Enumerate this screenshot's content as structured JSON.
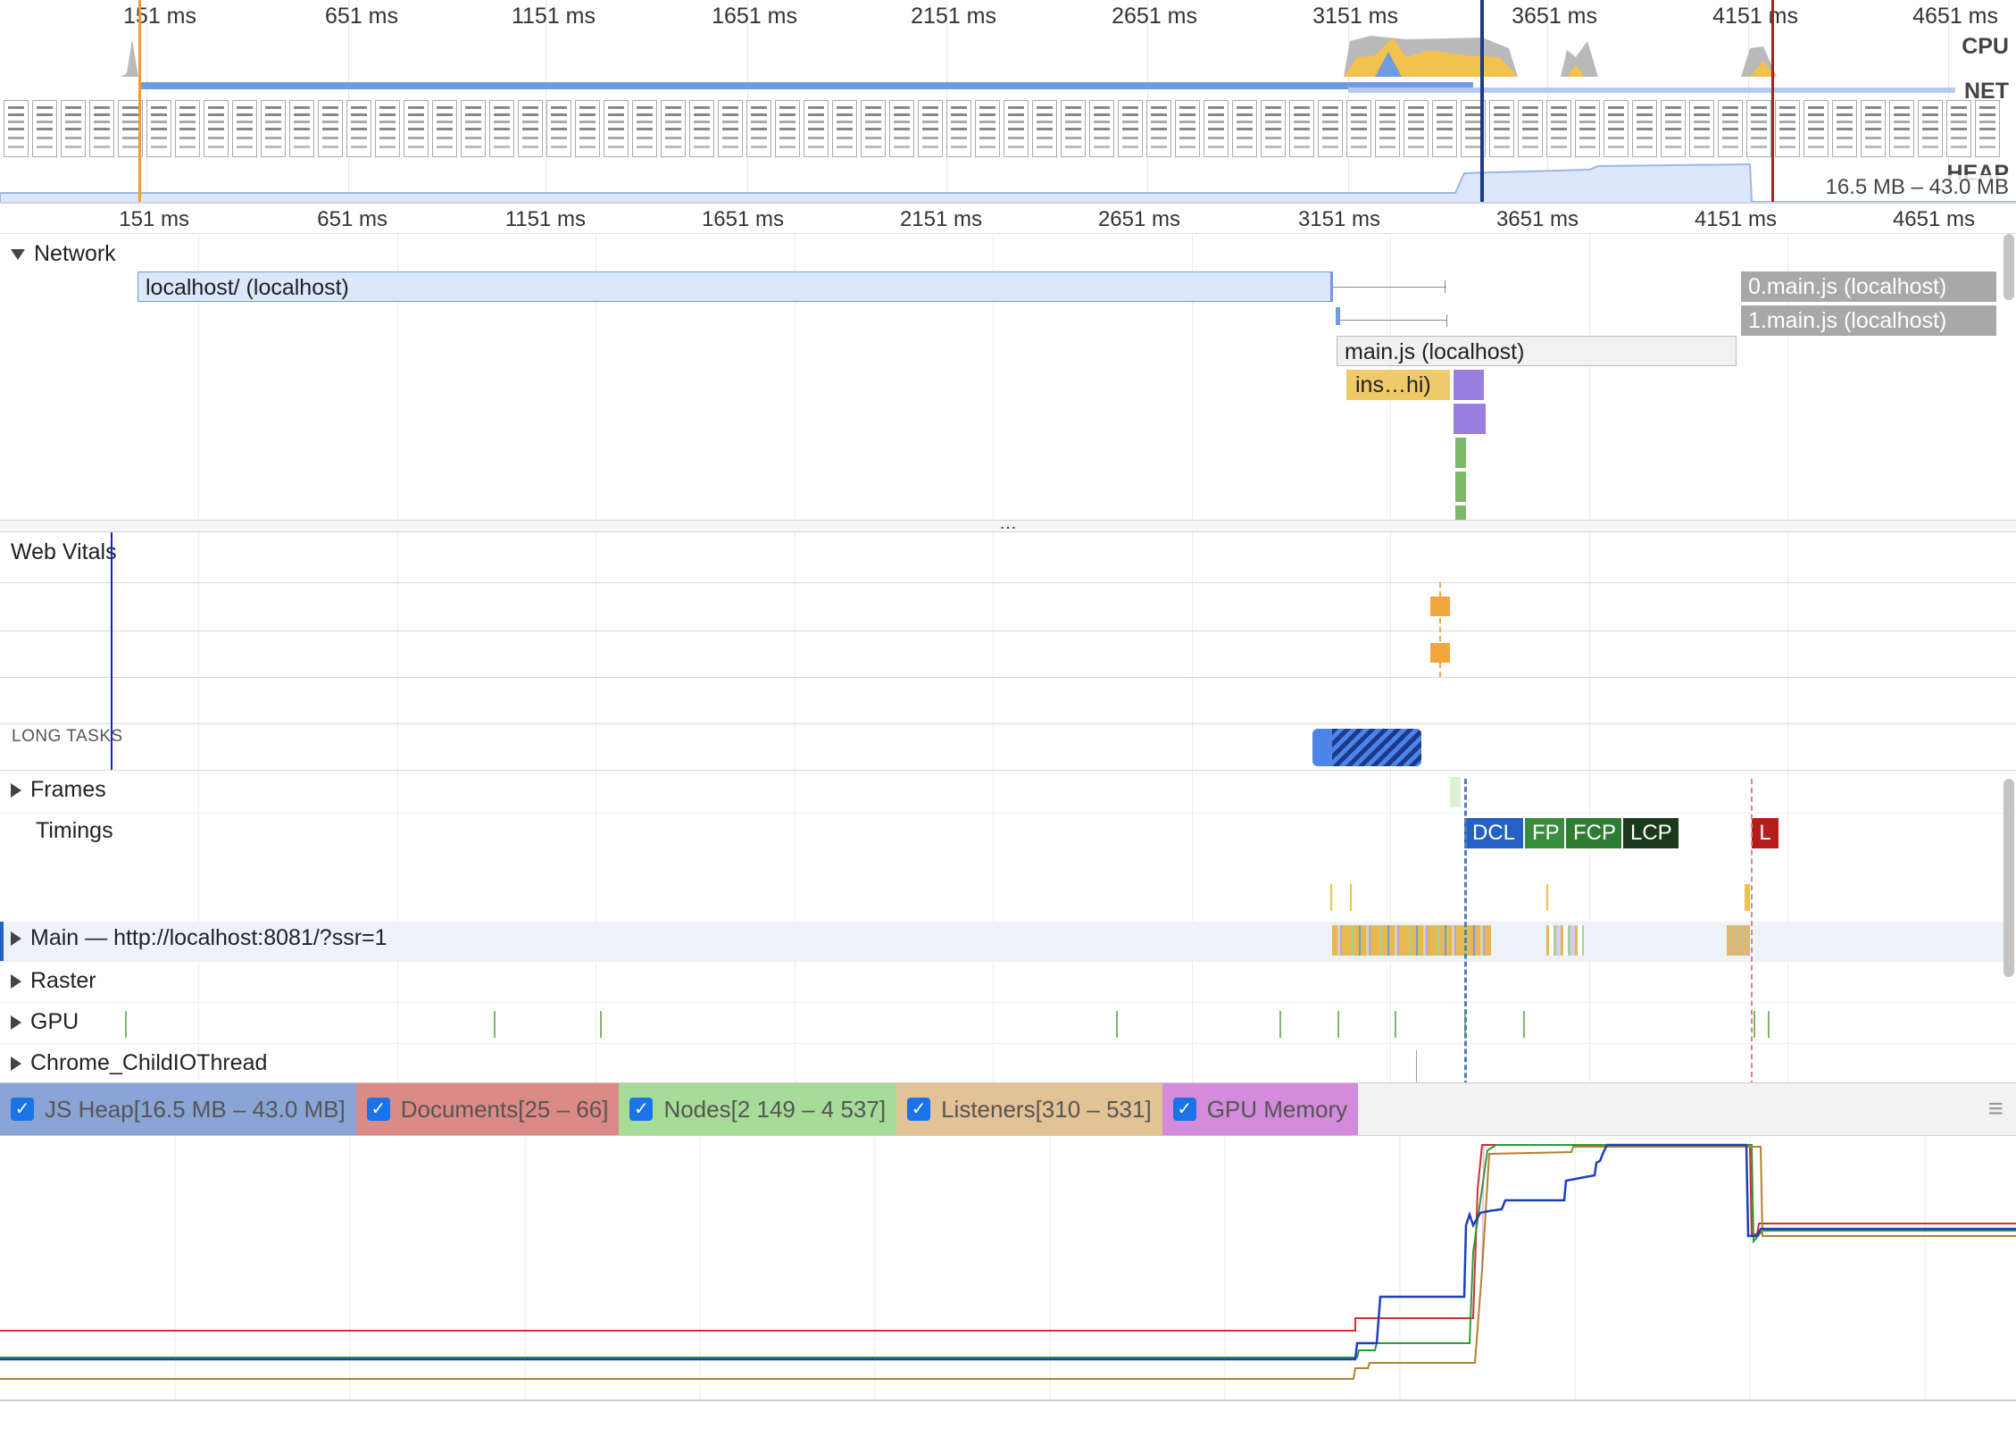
{
  "overview": {
    "ticks": [
      "151 ms",
      "651 ms",
      "1151 ms",
      "1651 ms",
      "2151 ms",
      "2651 ms",
      "3151 ms",
      "3651 ms",
      "4151 ms",
      "4651 ms"
    ],
    "cpu_label": "CPU",
    "net_label": "NET",
    "heap_label": "HEAP",
    "heap_range": "16.5 MB – 43.0 MB"
  },
  "ruler": {
    "ticks": [
      "151 ms",
      "651 ms",
      "1151 ms",
      "1651 ms",
      "2151 ms",
      "2651 ms",
      "3151 ms",
      "3651 ms",
      "4151 ms",
      "4651 ms"
    ]
  },
  "network": {
    "title": "Network",
    "requests": {
      "doc": "localhost/ (localhost)",
      "main_js": "main.js (localhost)",
      "chunk0": "0.main.js (localhost)",
      "chunk1": "1.main.js (localhost)",
      "ins": "ins…hi)"
    },
    "more": "…"
  },
  "tracks": {
    "web_vitals": "Web Vitals",
    "long_tasks": "LONG TASKS",
    "frames": "Frames",
    "timings": "Timings",
    "main": "Main — http://localhost:8081/?ssr=1",
    "raster": "Raster",
    "gpu": "GPU",
    "io": "Chrome_ChildIOThread"
  },
  "timings": {
    "dcl": "DCL",
    "fp": "FP",
    "fcp": "FCP",
    "lcp": "LCP",
    "l": "L"
  },
  "counters": [
    {
      "label": "JS Heap[16.5 MB – 43.0 MB]",
      "bg": "#8ba4d6",
      "color": "#1a3fc0"
    },
    {
      "label": "Documents[25 – 66]",
      "bg": "#dc8a85",
      "color": "#d32f2f"
    },
    {
      "label": "Nodes[2 149 – 4 537]",
      "bg": "#a6dc98",
      "color": "#2e9b35"
    },
    {
      "label": "Listeners[310 – 531]",
      "bg": "#e3c296",
      "color": "#b5802d"
    },
    {
      "label": "GPU Memory",
      "bg": "#d38bdb",
      "color": "#a53fb2"
    }
  ],
  "counter_check": "✓",
  "menu_icon": "hamburger-icon",
  "colors": {
    "accent": "#1a73e8",
    "dcl": "#2561c4",
    "fp": "#388e3c",
    "fcp": "#2e7d32",
    "lcp": "#1b3a1d",
    "load": "#b71c1c",
    "heap_line": "#1a3fc0",
    "documents_line": "#d32f2f",
    "nodes_line": "#2e9b35",
    "listeners_line": "#b5802d"
  }
}
